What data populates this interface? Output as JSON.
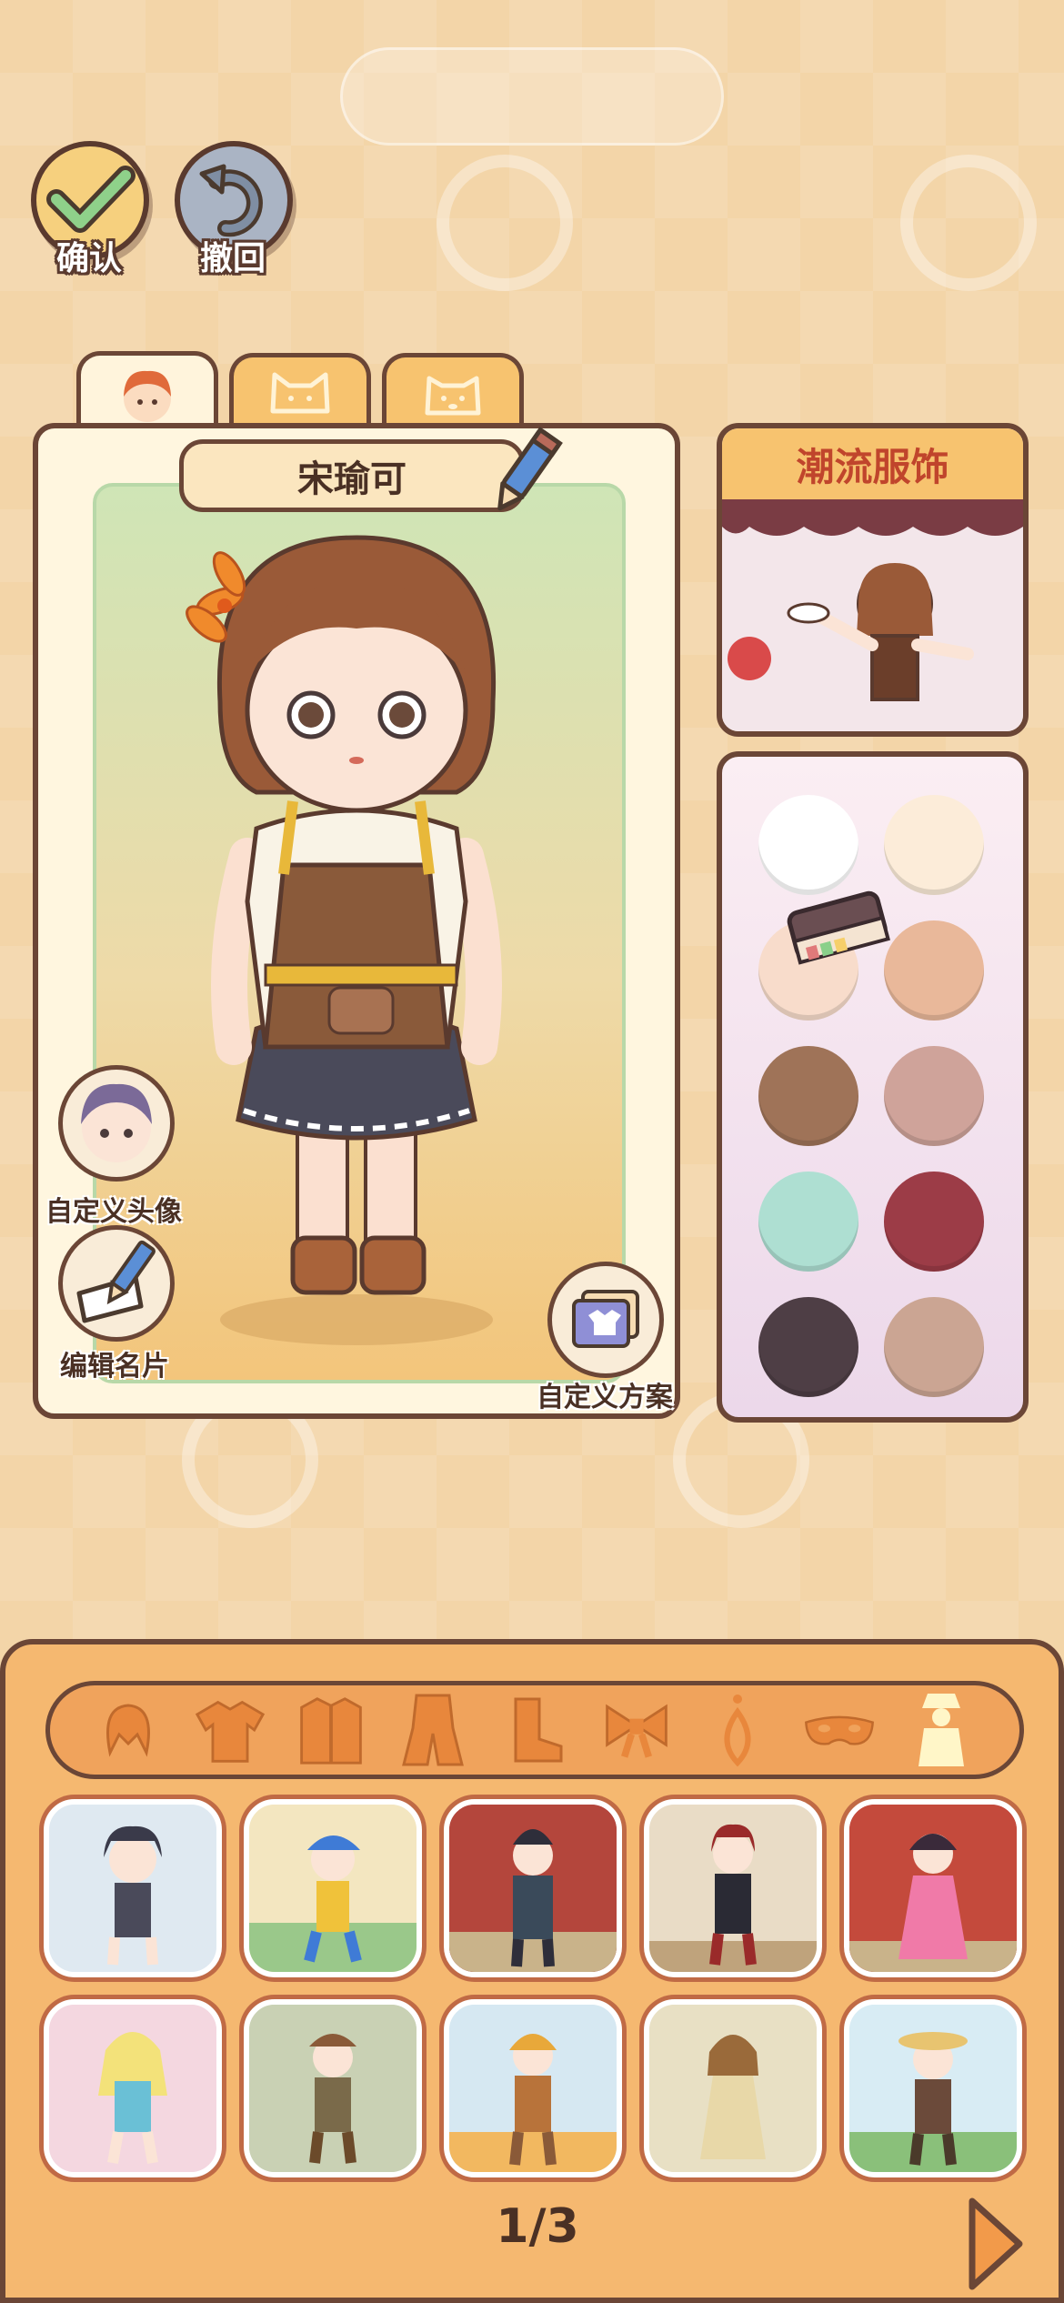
{
  "toolbar": {
    "confirm_label": "确认",
    "undo_label": "撤回"
  },
  "tabs": [
    {
      "icon": "girl-face-icon",
      "active": true
    },
    {
      "icon": "cat-face-icon",
      "active": false
    },
    {
      "icon": "dog-face-icon",
      "active": false
    }
  ],
  "character": {
    "name": "宋瑜可"
  },
  "side_actions": {
    "avatar_label": "自定义头像",
    "card_label": "编辑名片",
    "scheme_label": "自定义方案"
  },
  "trend": {
    "title": "潮流服饰"
  },
  "palette": {
    "colors": [
      "#ffffff",
      "#fcecd9",
      "#f8dccb",
      "#e9b89a",
      "#9f7358",
      "#cfa39a",
      "#aedfd2",
      "#9c3c47",
      "#4e3e45",
      "#cba593"
    ]
  },
  "categories": [
    "hair-icon",
    "shirt-icon",
    "coat-icon",
    "outfit-icon",
    "boots-icon",
    "bow-icon",
    "earring-icon",
    "mask-icon",
    "full-look-icon"
  ],
  "pagination": {
    "page_text": "1/3"
  }
}
